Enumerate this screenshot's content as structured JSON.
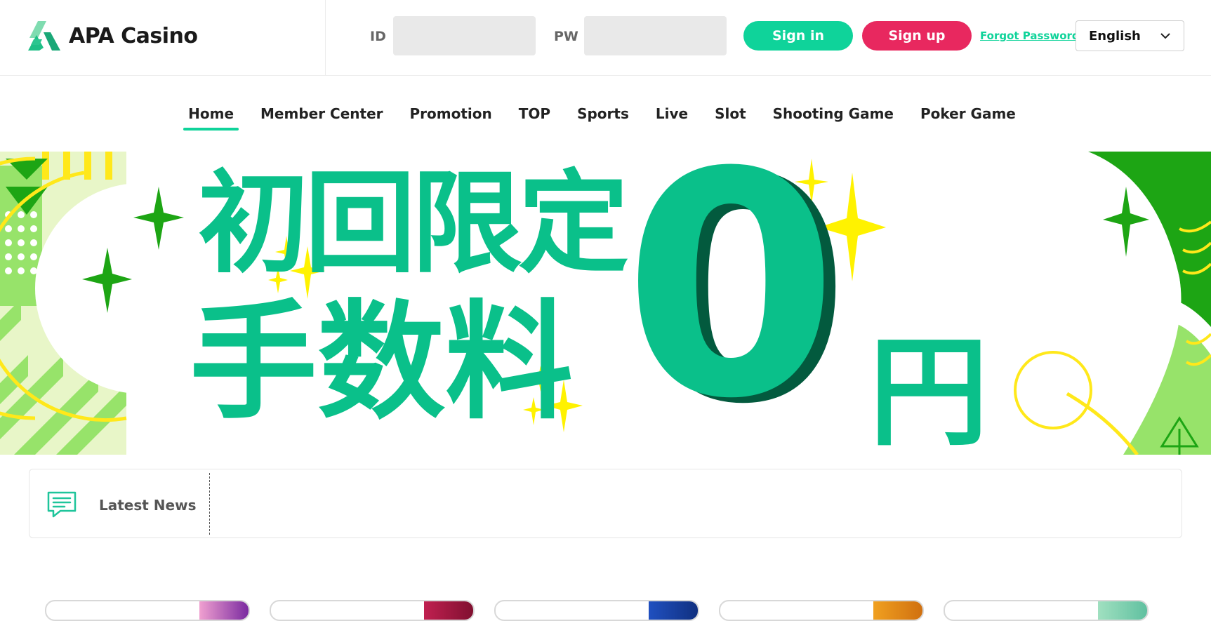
{
  "header": {
    "logo_text": "APA Casino",
    "id_label": "ID",
    "id_value": "",
    "pw_label": "PW",
    "pw_value": "",
    "signin_label": "Sign in",
    "signup_label": "Sign up",
    "forgot_label": "Forgot Password",
    "language": "English"
  },
  "nav": {
    "items": [
      {
        "label": "Home",
        "active": true
      },
      {
        "label": "Member Center"
      },
      {
        "label": "Promotion"
      },
      {
        "label": "TOP"
      },
      {
        "label": "Sports"
      },
      {
        "label": "Live"
      },
      {
        "label": "Slot"
      },
      {
        "label": "Shooting Game"
      },
      {
        "label": "Poker Game"
      }
    ]
  },
  "banner": {
    "line1": "初回限定",
    "line2": "手数料",
    "amount": "0",
    "currency": "円",
    "slide_count": 2
  },
  "news": {
    "label": "Latest News",
    "icon": "chat-lines-icon"
  },
  "colors": {
    "brand_green": "#0fd39a",
    "signup_pink": "#e8285f",
    "banner_green": "#0ac08a",
    "banner_dark": "#035a3e",
    "sparkle_yellow": "#fff200",
    "leaf_green": "#19a90f"
  }
}
